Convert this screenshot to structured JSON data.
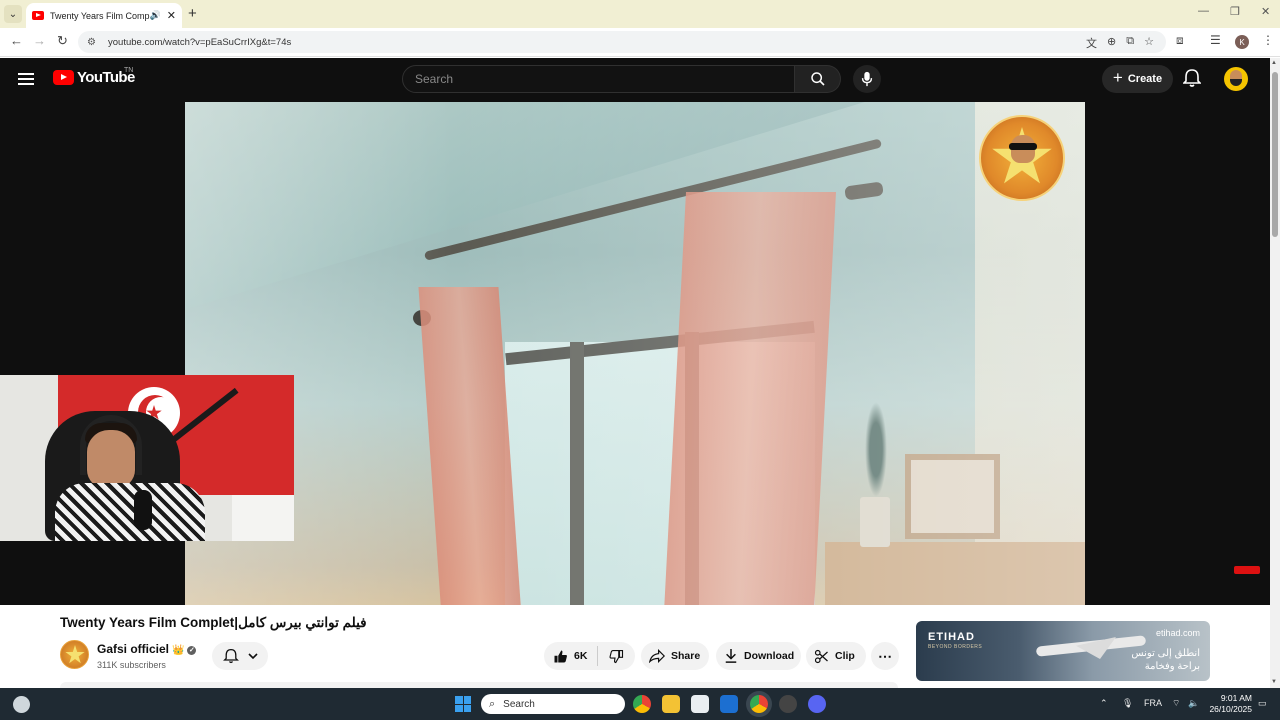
{
  "browser": {
    "tab_title": "Twenty Years Film Complet",
    "url": "youtube.com/watch?v=pEaSuCrrIXg&t=74s",
    "profile_initial": "K"
  },
  "youtube": {
    "logo_text": "YouTube",
    "logo_suffix": "TN",
    "search_placeholder": "Search",
    "create_label": "Create",
    "video_title": "Twenty Years Film Complet|فيلم توانتي بيرس كامل",
    "channel_name": "Gafsi officiel",
    "channel_subscribers": "311K subscribers",
    "likes": "6K",
    "share_label": "Share",
    "download_label": "Download",
    "clip_label": "Clip",
    "more_label": "⋯"
  },
  "ad": {
    "brand": "ETIHAD",
    "brand_sub": "BEYOND BORDERS",
    "url": "etihad.com",
    "arabic_line1": "انطلق إلى تونس",
    "arabic_line2": "براحة وفخامة"
  },
  "taskbar": {
    "search_label": "Search",
    "language": "FRA",
    "time": "9:01 AM",
    "date": "26/10/2025"
  },
  "colors": {
    "youtube_red": "#ff0000",
    "dark_bg": "#0f0f0f",
    "taskbar": "#1f2a33"
  },
  "icons": [
    "hamburger-icon",
    "youtube-logo-icon",
    "search-icon",
    "mic-icon",
    "bell-icon",
    "like-icon",
    "dislike-icon",
    "share-icon",
    "download-icon",
    "clip-icon"
  ]
}
